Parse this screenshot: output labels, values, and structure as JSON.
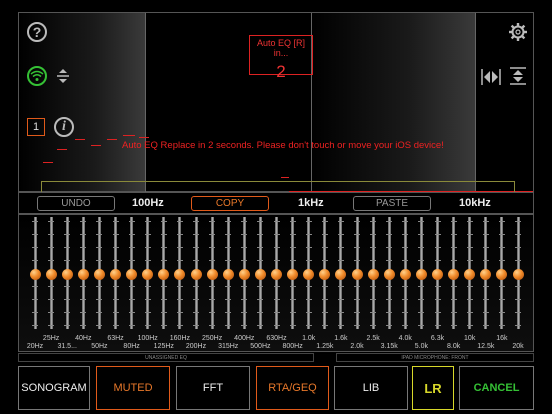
{
  "auto_eq": {
    "title": "Auto EQ [R] in...",
    "countdown": "2"
  },
  "message": "Auto EQ Replace in 2 seconds. Please don't touch or move your iOS device!",
  "channel_number": "1",
  "icons": {
    "help": "question-mark-circle",
    "wifi": "wifi",
    "expand_vertical": "expand-vertical",
    "info": "info-circle",
    "settings": "gear",
    "expand_horizontal": "expand-horizontal",
    "expand_vertical_right": "expand-vertical"
  },
  "toolbar": {
    "undo": "UNDO",
    "freq1": "100Hz",
    "copy": "COPY",
    "freq2": "1kHz",
    "paste": "PASTE",
    "freq3": "10kHz"
  },
  "eq_bands": {
    "upper": [
      "25Hz",
      "40Hz",
      "63Hz",
      "100Hz",
      "160Hz",
      "250Hz",
      "400Hz",
      "630Hz",
      "1.0k",
      "1.6k",
      "2.5k",
      "4.0k",
      "6.3k",
      "10k",
      "16k"
    ],
    "lower": [
      "20Hz",
      "31.5...",
      "50Hz",
      "80Hz",
      "125Hz",
      "200Hz",
      "315Hz",
      "500Hz",
      "800Hz",
      "1.25k",
      "2.0k",
      "3.15k",
      "5.0k",
      "8.0k",
      "12.5k",
      "20k"
    ]
  },
  "info": {
    "left": "UNASSIGNED EQ",
    "right": "IPAD MICROPHONE: FRONT"
  },
  "bottom": {
    "sonogram": "SONOGRAM",
    "muted": "MUTED",
    "fft": "FFT",
    "rta": "RTA/GEQ",
    "lib": "LIB",
    "lr": "LR",
    "cancel": "CANCEL"
  },
  "colors": {
    "accent_orange": "#e05a1a",
    "alert_red": "#dd2222",
    "green": "#35c135",
    "lr_yellow": "#d8d82a"
  }
}
